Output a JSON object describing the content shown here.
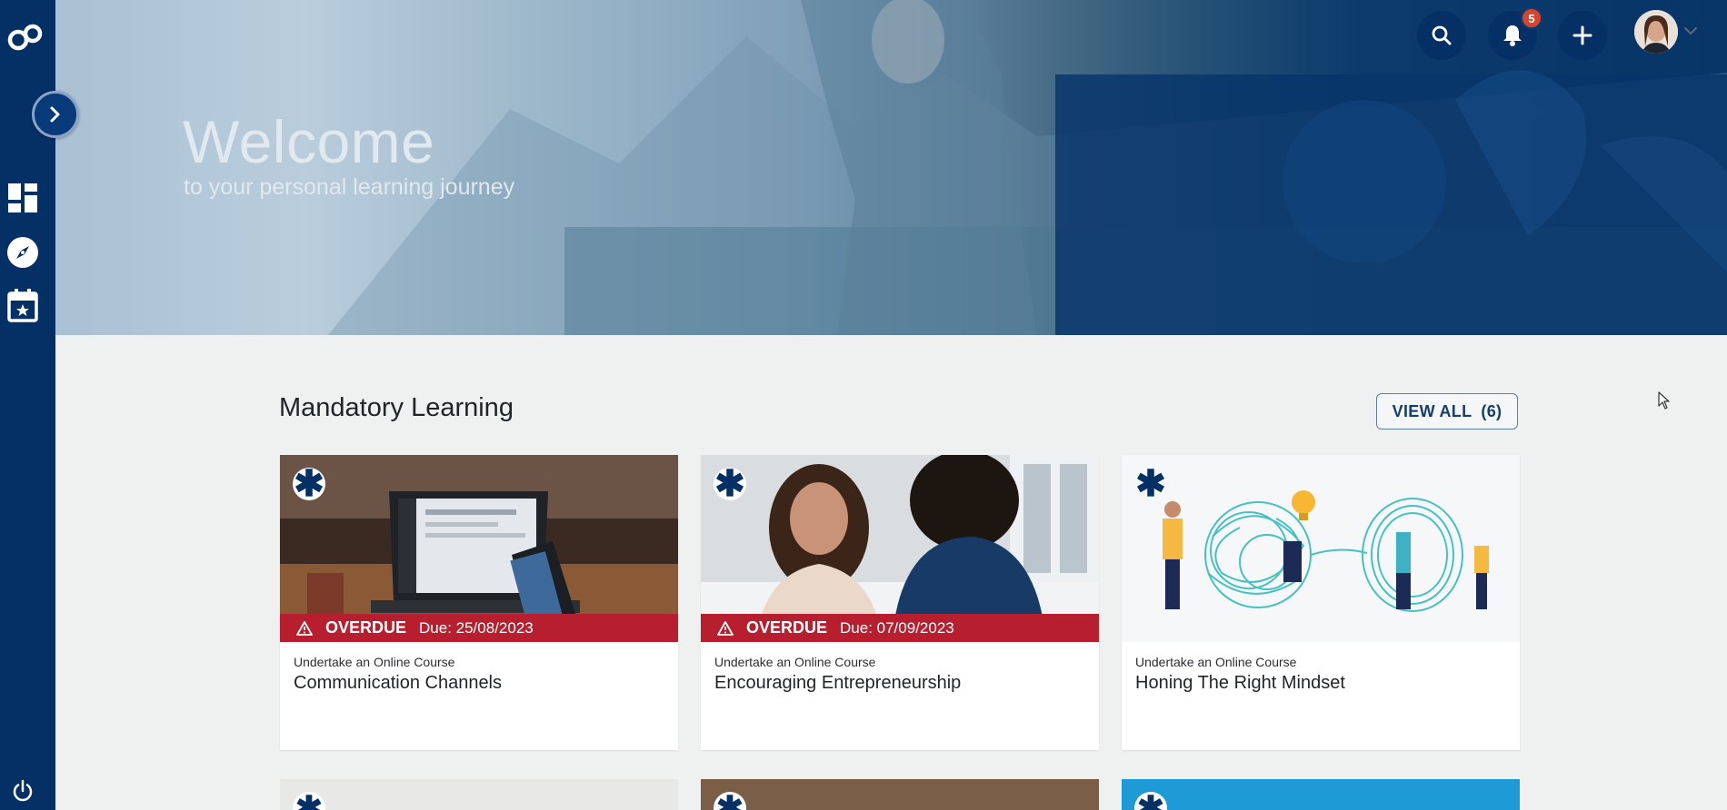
{
  "hero": {
    "title": "Welcome",
    "subtitle": "to your personal learning journey"
  },
  "header": {
    "notifications_count": "5",
    "icons": [
      "search-icon",
      "bell-icon",
      "plus-icon",
      "chevron-down-icon"
    ]
  },
  "sidebar": {
    "icons": [
      "logo",
      "chevron-right-icon",
      "dashboard-icon",
      "compass-icon",
      "calendar-star-icon",
      "power-icon"
    ]
  },
  "section": {
    "title": "Mandatory Learning",
    "view_all_label": "VIEW ALL",
    "view_all_count": "(6)"
  },
  "cards": [
    {
      "type": "Undertake an Online Course",
      "title": "Communication Channels",
      "status": "OVERDUE",
      "due": "Due: 25/08/2023"
    },
    {
      "type": "Undertake an Online Course",
      "title": "Encouraging Entrepreneurship",
      "status": "OVERDUE",
      "due": "Due: 07/09/2023"
    },
    {
      "type": "Undertake an Online Course",
      "title": "Honing The Right Mindset"
    }
  ],
  "colors": {
    "sidebar": "#053066",
    "overdue": "#b71f2f",
    "badge": "#d6452d",
    "background": "#eff0f0"
  }
}
